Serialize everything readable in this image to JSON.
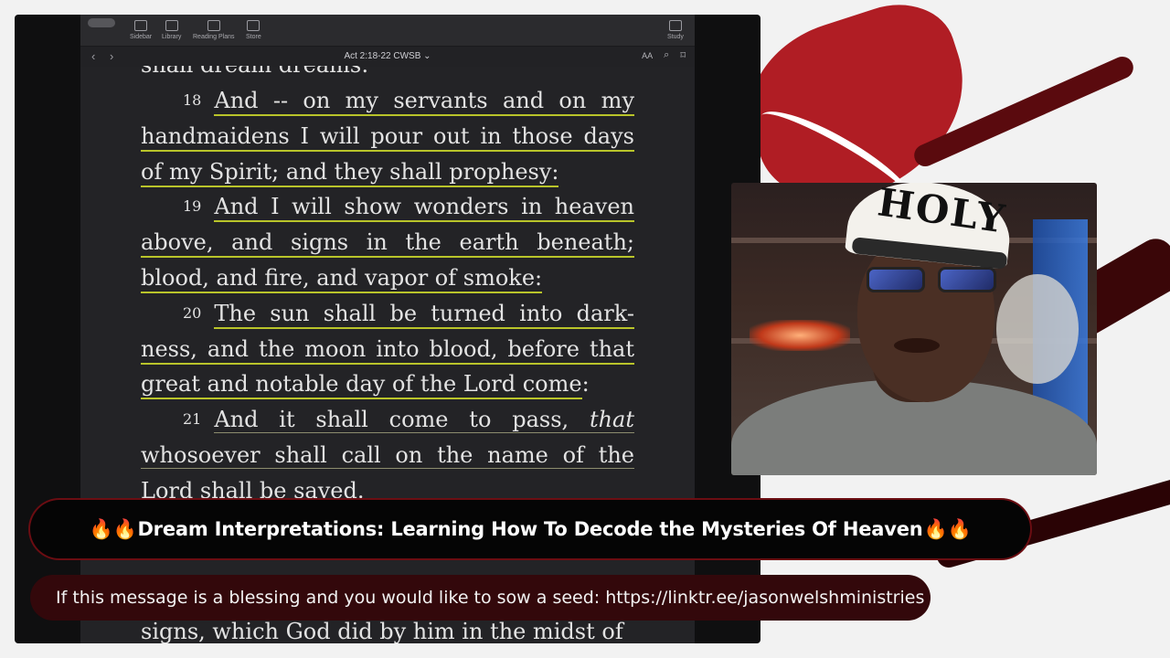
{
  "toolbar": {
    "items": [
      {
        "label": "Sidebar",
        "icon": "sidebar-icon"
      },
      {
        "label": "Library",
        "icon": "library-icon"
      },
      {
        "label": "Reading Plans",
        "icon": "reading-plans-icon"
      },
      {
        "label": "Store",
        "icon": "store-icon"
      }
    ],
    "study_label": "Study"
  },
  "nav": {
    "reference": "Act 2:18-22 CWSB ⌄",
    "aa_label": "AA"
  },
  "scripture": {
    "cut_line": "shall dream dreams:",
    "v18_num": "18",
    "v18_text": "And -- on my servants and on my handmaidens I will pour out in those days of my Spirit; and they shall prophesy:",
    "v19_num": "19",
    "v19_text": "And I will show wonders in heaven above, and signs in the earth beneath; blood, and fire, and vapor of smoke:",
    "v20_num": "20",
    "v20_text_a": "The sun shall be turned into dark-ness, and the moon into blood, before that great and notable day of the Lord ",
    "v20_come": "come",
    "v20_end": ":",
    "v21_num": "21",
    "v21_text_a": "And it shall come to pass, ",
    "v21_that": "that",
    "v21_text_b": " whosoever shall call on the name of the Lord shall be saved.",
    "bottom_line": "signs, which God did by him in the midst of"
  },
  "webcam": {
    "cap_text": "HOLY"
  },
  "banners": {
    "fire_left": "🔥🔥",
    "title": "Dream Interpretations: Learning How To Decode the Mysteries Of Heaven",
    "fire_right": "🔥🔥",
    "message": "If this message is a blessing and you would like to sow a seed: https://linktr.ee/jasonwelshministries"
  },
  "colors": {
    "highlight": "#b9c42a",
    "accent_red": "#b01d24",
    "banner_dark": "#33080b"
  }
}
